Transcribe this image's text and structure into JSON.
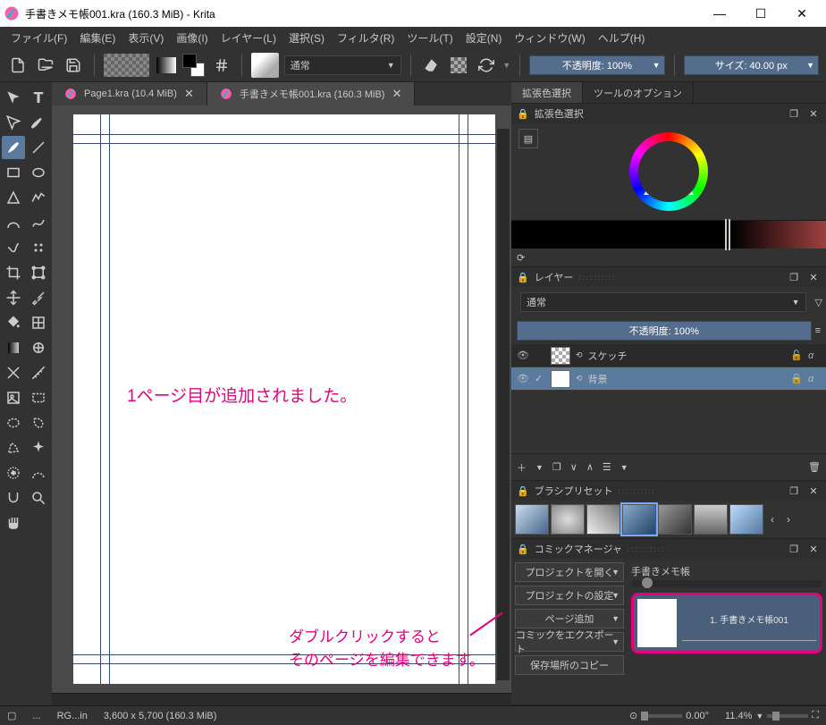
{
  "title": "手書きメモ帳001.kra (160.3 MiB)  -  Krita",
  "menu": [
    "ファイル(F)",
    "編集(E)",
    "表示(V)",
    "画像(I)",
    "レイヤー(L)",
    "選択(S)",
    "フィルタ(R)",
    "ツール(T)",
    "設定(N)",
    "ウィンドウ(W)",
    "ヘルプ(H)"
  ],
  "toolbar": {
    "blendmode": "通常",
    "opacity": "不透明度:  100%",
    "size": "サイズ:  40.00 px"
  },
  "tabs": [
    {
      "label": "Page1.kra (10.4 MiB)",
      "active": false
    },
    {
      "label": "手書きメモ帳001.kra (160.3 MiB)",
      "active": true
    }
  ],
  "annot1": "1ページ目が追加されました。",
  "annot2a": "ダブルクリックすると",
  "annot2b": "そのページを編集できます。",
  "rightTabs": [
    "拡張色選択",
    "ツールのオプション"
  ],
  "colorPanel": {
    "title": "拡張色選択"
  },
  "layerPanel": {
    "title": "レイヤー",
    "blendmode": "通常",
    "opacity": "不透明度:  100%",
    "layers": [
      {
        "name": "スケッチ",
        "visible": true,
        "checked": false,
        "checker": true,
        "locked": false,
        "alpha": true
      },
      {
        "name": "背景",
        "visible": true,
        "checked": true,
        "checker": false,
        "locked": true,
        "alpha": true
      }
    ]
  },
  "brushPanel": {
    "title": "ブラシプリセット"
  },
  "comicPanel": {
    "title": "コミックマネージャ",
    "buttons": [
      "プロジェクトを開く",
      "プロジェクトの設定",
      "ページ追加",
      "コミックをエクスポート",
      "保存場所のコピー"
    ],
    "project": "手書きメモ帳",
    "page": "1. 手書きメモ帳001"
  },
  "status": {
    "left1": "RG...in",
    "dims": "3,600 x 5,700 (160.3 MiB)",
    "angle": "0.00°",
    "zoom": "11.4%"
  }
}
